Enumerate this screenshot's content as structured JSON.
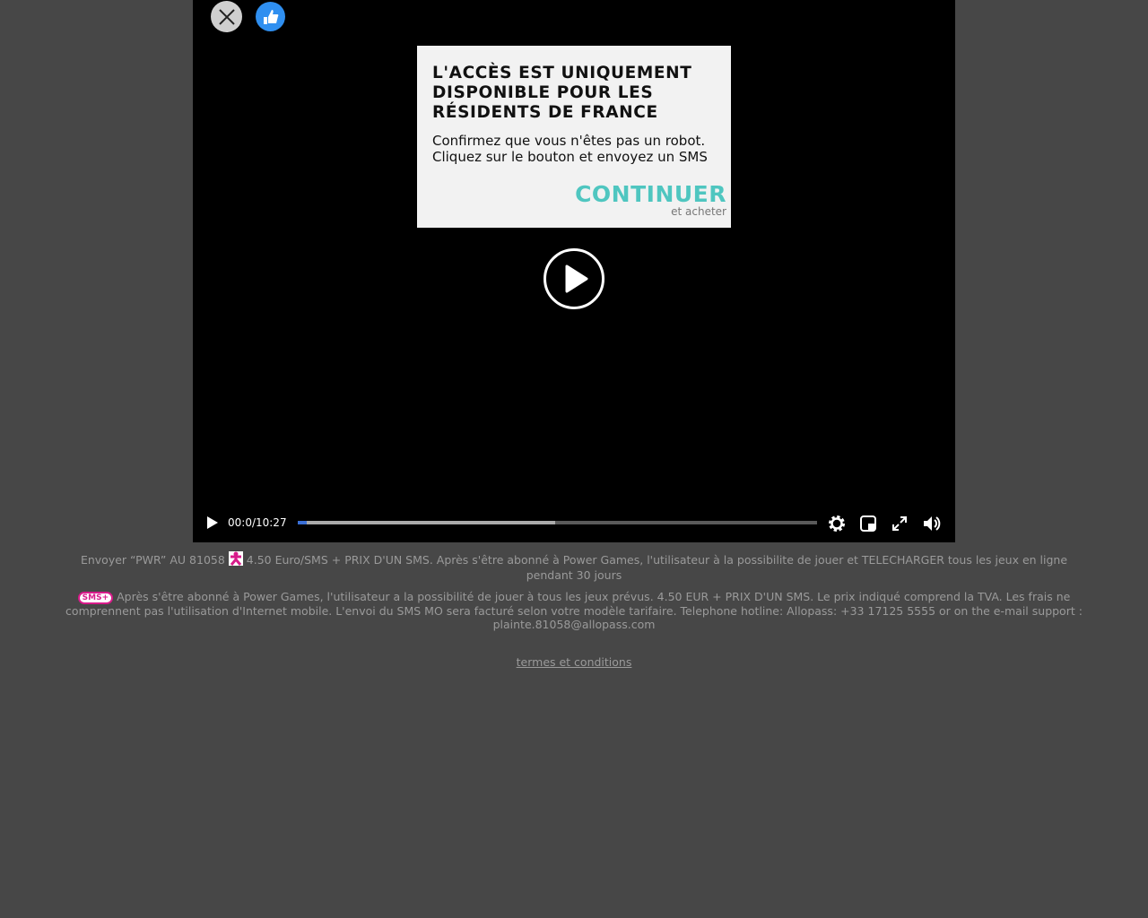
{
  "dialog": {
    "title": "L'ACCÈS EST UNIQUEMENT DISPONIBLE POUR LES RÉSIDENTS DE FRANCE",
    "body": "Confirmez que vous n'êtes pas un robot. Cliquez sur le bouton et envoyez un SMS",
    "continue_label": "CONTINUER",
    "sub_label": "et acheter"
  },
  "player": {
    "time": "00:0/10:27",
    "played_fraction": 0.017,
    "buffered_fraction": 0.496
  },
  "footer": {
    "line1_a": "Envoyer “PWR” AU 81058",
    "line1_b": "4.50 Euro/SMS + PRIX D'UN SMS. Après s'être abonné à Power Games, l'utilisateur à la possibilite de jouer et TELECHARGER tous les jeux en ligne pendant 30 jours",
    "sms_badge": "SMS+",
    "line2": "Après s'être abonné à Power Games, l'utilisateur a la possibilité de jouer à tous les jeux prévus. 4.50 EUR + PRIX D'UN SMS. Le prix indiqué comprend la TVA. Les frais ne comprennent pas l'utilisation d'Internet mobile. L'envoi du SMS MO sera facturé selon votre modèle tarifaire. Telephone hotline: Allopass: +33 17125 5555 or on the e-mail support : plainte.81058@allopass.com",
    "terms": "termes et conditions"
  }
}
